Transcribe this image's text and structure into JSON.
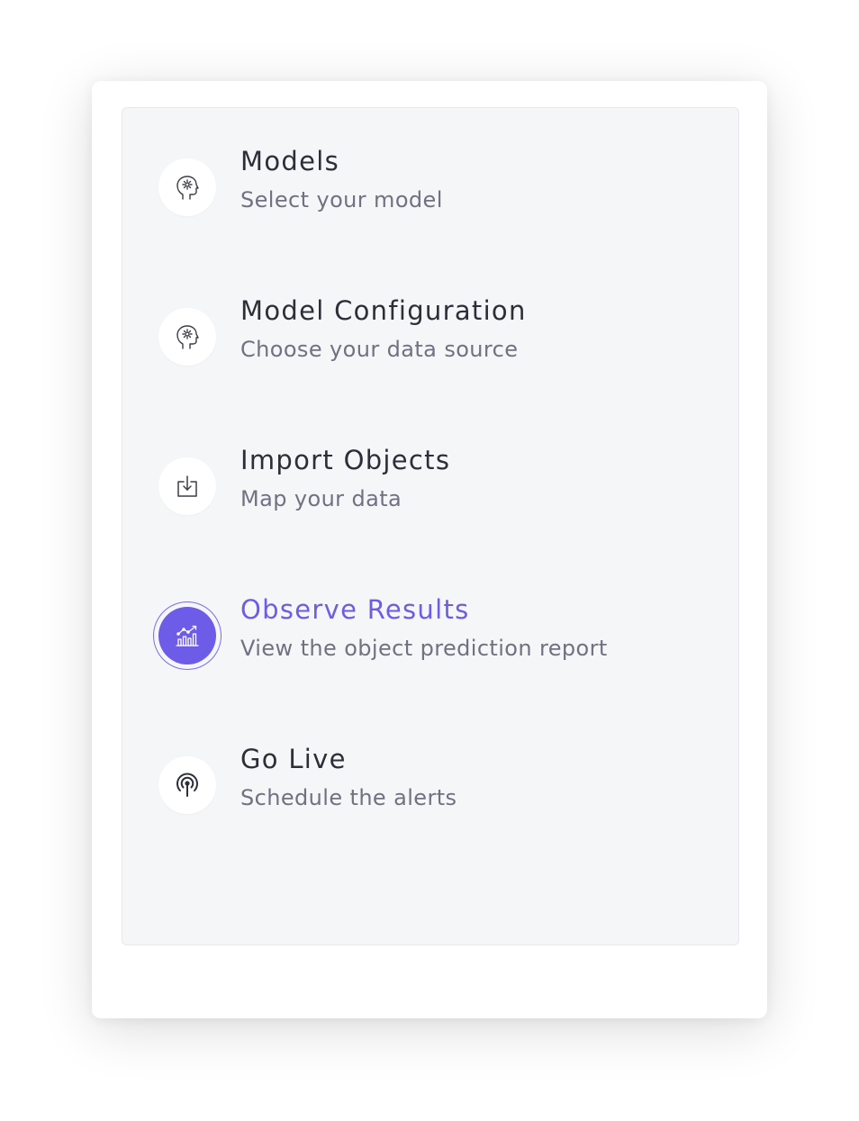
{
  "steps": [
    {
      "title": "Models",
      "subtitle": "Select your model",
      "icon": "brain-head-icon",
      "active": false
    },
    {
      "title": "Model Configuration",
      "subtitle": "Choose your data source",
      "icon": "brain-head-icon",
      "active": false
    },
    {
      "title": "Import Objects",
      "subtitle": "Map your data",
      "icon": "import-icon",
      "active": false
    },
    {
      "title": "Observe Results",
      "subtitle": "View the object prediction report",
      "icon": "chart-growth-icon",
      "active": true
    },
    {
      "title": "Go Live",
      "subtitle": "Schedule the alerts",
      "icon": "broadcast-icon",
      "active": false
    }
  ],
  "colors": {
    "accent": "#6c5ce7",
    "title": "#2c2f38",
    "subtitle": "#6e7281",
    "panel_bg": "#f5f6f8"
  }
}
